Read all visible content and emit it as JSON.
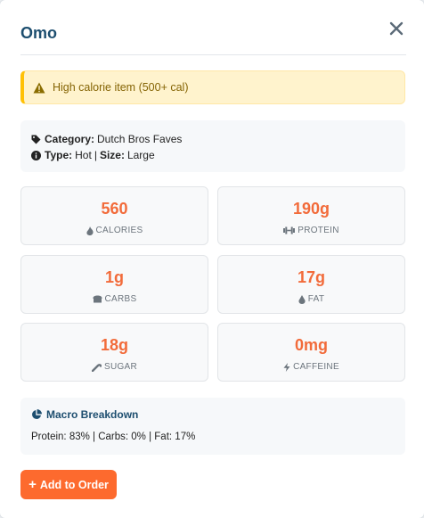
{
  "modal": {
    "title": "Omo",
    "close_icon": "close-icon"
  },
  "alert": {
    "icon": "warning-triangle-icon",
    "text": "High calorie item (500+ cal)",
    "color_text": "#856404",
    "color_bg": "#fff3cd"
  },
  "info": {
    "category_label": "Category:",
    "category_value": "Dutch Bros Faves",
    "type_label": "Type:",
    "type_value": "Hot",
    "separator": "|",
    "size_label": "Size:",
    "size_value": "Large"
  },
  "nutrition": [
    {
      "value": "560",
      "label": "CALORIES",
      "icon": "fire-icon"
    },
    {
      "value": "190g",
      "label": "PROTEIN",
      "icon": "dumbbell-icon"
    },
    {
      "value": "1g",
      "label": "CARBS",
      "icon": "bread-icon"
    },
    {
      "value": "17g",
      "label": "FAT",
      "icon": "droplet-icon"
    },
    {
      "value": "18g",
      "label": "SUGAR",
      "icon": "candy-cane-icon"
    },
    {
      "value": "0mg",
      "label": "CAFFEINE",
      "icon": "bolt-icon"
    }
  ],
  "macro": {
    "title": "Macro Breakdown",
    "icon": "pie-chart-icon",
    "text": "Protein: 83% | Carbs: 0% | Fat: 17%"
  },
  "button": {
    "label": "Add to Order",
    "icon": "plus-icon"
  },
  "colors": {
    "accent": "#f26b3a",
    "button": "#fd6a2e",
    "title": "#1d4e6f"
  }
}
